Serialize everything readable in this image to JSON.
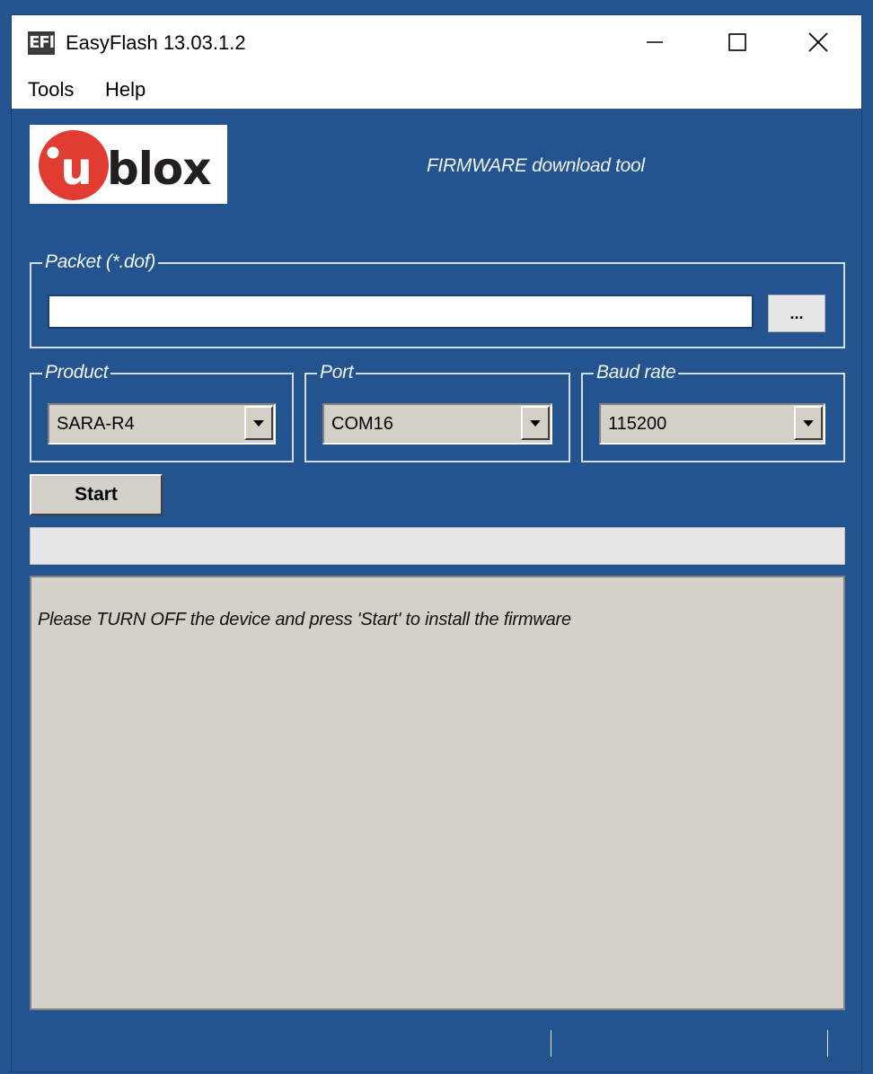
{
  "window": {
    "icon_text": "EFl",
    "title": "EasyFlash 13.03.1.2"
  },
  "menu": {
    "items": [
      "Tools",
      "Help"
    ]
  },
  "header": {
    "logo_u": "u",
    "logo_rest": "blox",
    "tagline": "FIRMWARE download tool",
    "brand_color": "#e03c31"
  },
  "packet": {
    "legend": "Packet (*.dof)",
    "path_value": "",
    "browse_label": "..."
  },
  "product": {
    "legend": "Product",
    "selected": "SARA-R4"
  },
  "port": {
    "legend": "Port",
    "selected": "COM16"
  },
  "baud": {
    "legend": "Baud rate",
    "selected": "115200"
  },
  "actions": {
    "start_label": "Start"
  },
  "progress": {
    "fraction": 0
  },
  "log": {
    "message": "Please TURN OFF the device and press 'Start' to install the firmware"
  },
  "icons": {
    "minimize": "minimize-icon",
    "maximize": "maximize-icon",
    "close": "close-icon",
    "dropdown": "chevron-down-icon"
  },
  "colors": {
    "background": "#24548f",
    "log_background": "#d4d0c8"
  }
}
